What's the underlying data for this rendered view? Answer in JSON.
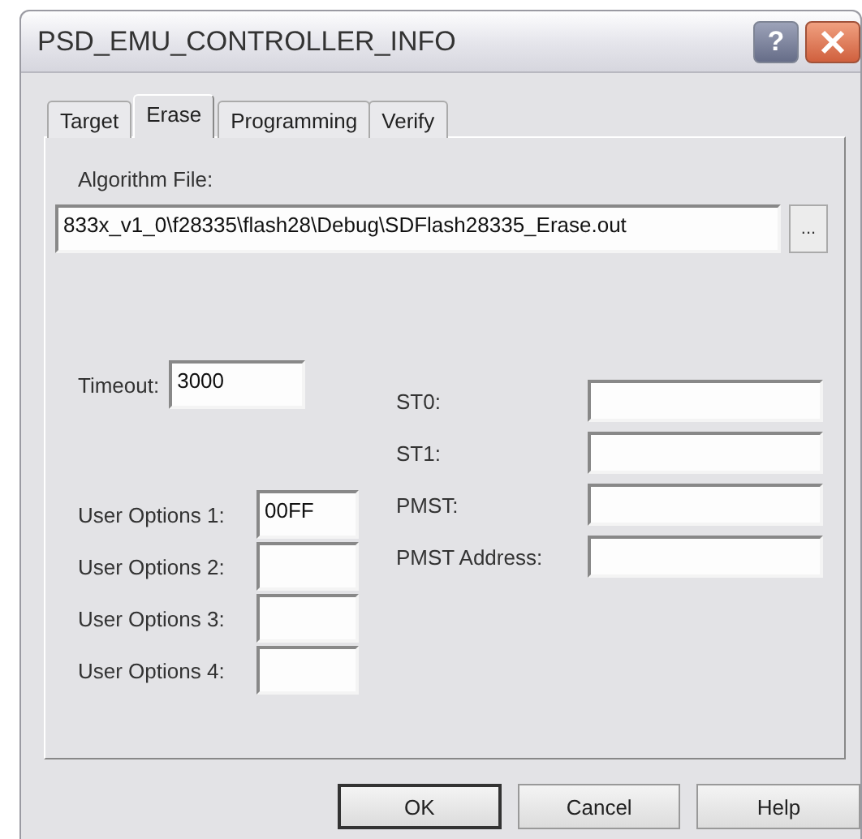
{
  "window": {
    "title": "PSD_EMU_CONTROLLER_INFO",
    "help_button": "?"
  },
  "tabs": [
    {
      "label": "Target",
      "selected": false
    },
    {
      "label": "Erase",
      "selected": true
    },
    {
      "label": "Programming",
      "selected": false
    },
    {
      "label": "Verify",
      "selected": false
    }
  ],
  "algorithm_file": {
    "label": "Algorithm File:",
    "value": "833x_v1_0\\f28335\\flash28\\Debug\\SDFlash28335_Erase.out",
    "browse_button": "..."
  },
  "timeout": {
    "label": "Timeout:",
    "value": "3000"
  },
  "user_options": [
    {
      "label": "User Options 1:",
      "value": "00FF"
    },
    {
      "label": "User Options 2:"
    },
    {
      "label": "User Options 3:"
    },
    {
      "label": "User Options 4:"
    }
  ],
  "registers": [
    {
      "label": "ST0:"
    },
    {
      "label": "ST1:"
    },
    {
      "label": "PMST:"
    },
    {
      "label": "PMST Address:"
    }
  ],
  "buttons": [
    {
      "label": "OK",
      "default": true
    },
    {
      "label": "Cancel",
      "default": false
    },
    {
      "label": "Help",
      "default": false
    }
  ]
}
